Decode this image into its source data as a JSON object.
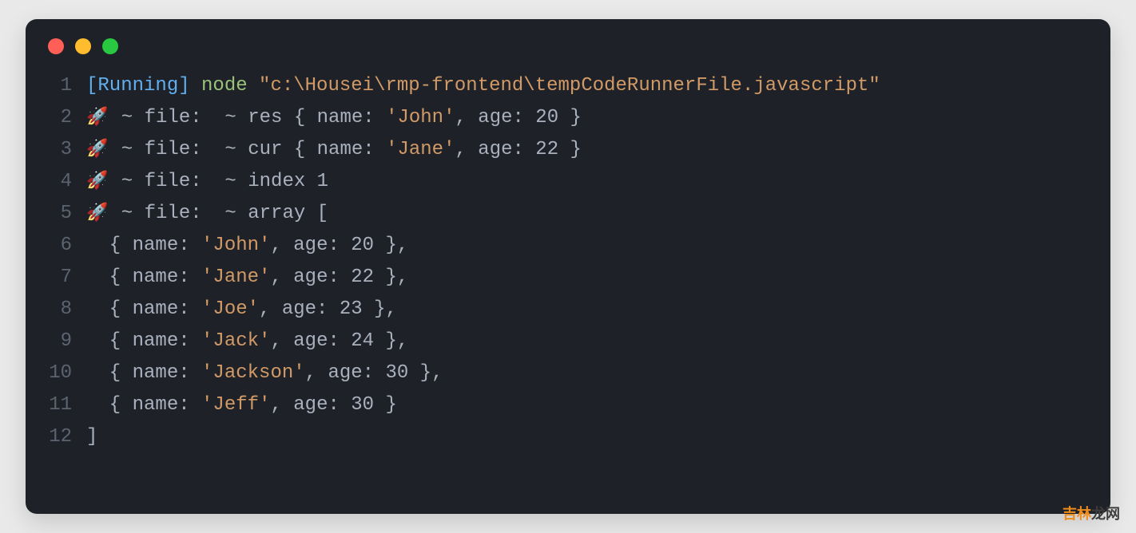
{
  "watermark": {
    "a": "吉林",
    "b": "龙网"
  },
  "lines": [
    {
      "n": "1",
      "segs": [
        {
          "t": "[Running]",
          "c": "token-blue"
        },
        {
          "t": " ",
          "c": "token-text"
        },
        {
          "t": "node",
          "c": "token-green"
        },
        {
          "t": " ",
          "c": "token-text"
        },
        {
          "t": "\"c:\\Housei\\rmp-frontend\\tempCodeRunnerFile.javascript\"",
          "c": "token-orange"
        }
      ]
    },
    {
      "n": "2",
      "rocket": true,
      "segs": [
        {
          "t": " ~ file:  ~ res { name: ",
          "c": "token-text"
        },
        {
          "t": "'John'",
          "c": "token-orange"
        },
        {
          "t": ", age: 20 }",
          "c": "token-text"
        }
      ]
    },
    {
      "n": "3",
      "rocket": true,
      "segs": [
        {
          "t": " ~ file:  ~ cur { name: ",
          "c": "token-text"
        },
        {
          "t": "'Jane'",
          "c": "token-orange"
        },
        {
          "t": ", age: 22 }",
          "c": "token-text"
        }
      ]
    },
    {
      "n": "4",
      "rocket": true,
      "segs": [
        {
          "t": " ~ file:  ~ index 1",
          "c": "token-text"
        }
      ]
    },
    {
      "n": "5",
      "rocket": true,
      "segs": [
        {
          "t": " ~ file:  ~ array [",
          "c": "token-text"
        }
      ]
    },
    {
      "n": "6",
      "segs": [
        {
          "t": "  { name: ",
          "c": "token-text"
        },
        {
          "t": "'John'",
          "c": "token-orange"
        },
        {
          "t": ", age: 20 },",
          "c": "token-text"
        }
      ]
    },
    {
      "n": "7",
      "segs": [
        {
          "t": "  { name: ",
          "c": "token-text"
        },
        {
          "t": "'Jane'",
          "c": "token-orange"
        },
        {
          "t": ", age: 22 },",
          "c": "token-text"
        }
      ]
    },
    {
      "n": "8",
      "segs": [
        {
          "t": "  { name: ",
          "c": "token-text"
        },
        {
          "t": "'Joe'",
          "c": "token-orange"
        },
        {
          "t": ", age: 23 },",
          "c": "token-text"
        }
      ]
    },
    {
      "n": "9",
      "segs": [
        {
          "t": "  { name: ",
          "c": "token-text"
        },
        {
          "t": "'Jack'",
          "c": "token-orange"
        },
        {
          "t": ", age: 24 },",
          "c": "token-text"
        }
      ]
    },
    {
      "n": "10",
      "segs": [
        {
          "t": "  { name: ",
          "c": "token-text"
        },
        {
          "t": "'Jackson'",
          "c": "token-orange"
        },
        {
          "t": ", age: 30 },",
          "c": "token-text"
        }
      ]
    },
    {
      "n": "11",
      "segs": [
        {
          "t": "  { name: ",
          "c": "token-text"
        },
        {
          "t": "'Jeff'",
          "c": "token-orange"
        },
        {
          "t": ", age: 30 }",
          "c": "token-text"
        }
      ]
    },
    {
      "n": "12",
      "segs": [
        {
          "t": "]",
          "c": "token-text"
        }
      ]
    }
  ]
}
